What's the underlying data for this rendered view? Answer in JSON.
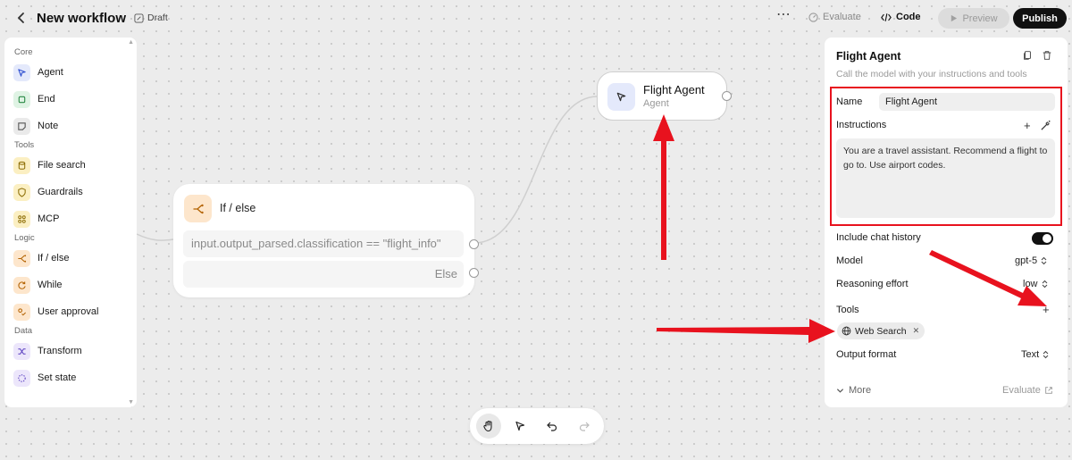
{
  "header": {
    "title": "New workflow",
    "draft": "Draft",
    "more": "⋯",
    "evaluate": "Evaluate",
    "code": "Code",
    "preview": "Preview",
    "publish": "Publish"
  },
  "palette": {
    "sections": [
      {
        "label": "Core",
        "items": [
          {
            "label": "Agent",
            "icon": "agent-cursor-icon"
          },
          {
            "label": "End",
            "icon": "end-square-icon"
          },
          {
            "label": "Note",
            "icon": "note-icon"
          }
        ]
      },
      {
        "label": "Tools",
        "items": [
          {
            "label": "File search",
            "icon": "database-icon"
          },
          {
            "label": "Guardrails",
            "icon": "shield-icon"
          },
          {
            "label": "MCP",
            "icon": "mcp-icon"
          }
        ]
      },
      {
        "label": "Logic",
        "items": [
          {
            "label": "If / else",
            "icon": "branch-icon"
          },
          {
            "label": "While",
            "icon": "loop-icon"
          },
          {
            "label": "User approval",
            "icon": "approval-icon"
          }
        ]
      },
      {
        "label": "Data",
        "items": [
          {
            "label": "Transform",
            "icon": "shuffle-icon"
          },
          {
            "label": "Set state",
            "icon": "dotted-circle-icon"
          }
        ]
      }
    ]
  },
  "canvas": {
    "ifelse_node": {
      "title": "If / else",
      "condition": "input.output_parsed.classification == \"flight_info\"",
      "else_label": "Else"
    },
    "agent_node": {
      "title": "Flight Agent",
      "subtitle": "Agent"
    }
  },
  "inspector": {
    "title": "Flight Agent",
    "description": "Call the model with your instructions and tools",
    "name_label": "Name",
    "name_value": "Flight Agent",
    "instructions_label": "Instructions",
    "instructions_value": "You are a travel assistant. Recommend a flight to go to. Use airport codes.",
    "chat_history_label": "Include chat history",
    "chat_history_on": true,
    "model_label": "Model",
    "model_value": "gpt-5",
    "reasoning_label": "Reasoning effort",
    "reasoning_value": "low",
    "tools_label": "Tools",
    "tool_chip": "Web Search",
    "output_label": "Output format",
    "output_value": "Text",
    "more_label": "More",
    "evaluate_label": "Evaluate"
  },
  "colors": {
    "highlight_red": "#e8121e",
    "publish_bg": "#111111"
  }
}
